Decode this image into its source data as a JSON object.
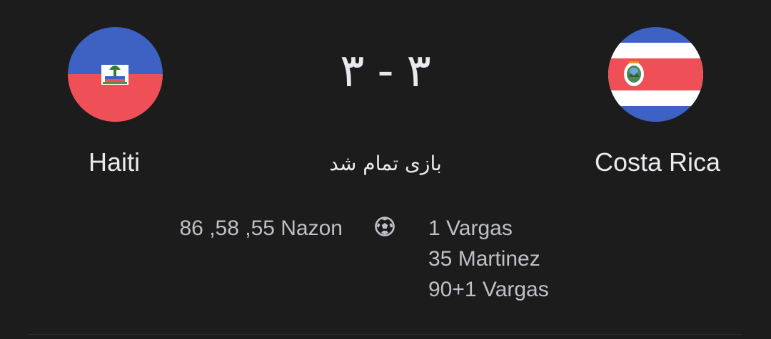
{
  "match": {
    "home_team": {
      "name": "Haiti",
      "flag_icon": "haiti-flag-icon",
      "flag_colors": {
        "top": "#3d62c3",
        "bottom": "#ef5058"
      }
    },
    "away_team": {
      "name": "Costa Rica",
      "flag_icon": "costa-rica-flag-icon",
      "flag_colors": {
        "blue": "#3d62c3",
        "white": "#ffffff",
        "red": "#ef5058"
      }
    },
    "score": {
      "home": "۳",
      "separator": "-",
      "away": "۳"
    },
    "status": "بازی تمام شد",
    "goals_icon": "soccer-ball-icon",
    "home_scorers": [
      "86 ,58 ,55 Nazon"
    ],
    "away_scorers": [
      "1 Vargas",
      "35 Martinez",
      "90+1 Vargas"
    ]
  },
  "colors": {
    "background": "#1d1c1d",
    "primary_text": "#e8eaed",
    "secondary_text": "#bdc1c6"
  }
}
